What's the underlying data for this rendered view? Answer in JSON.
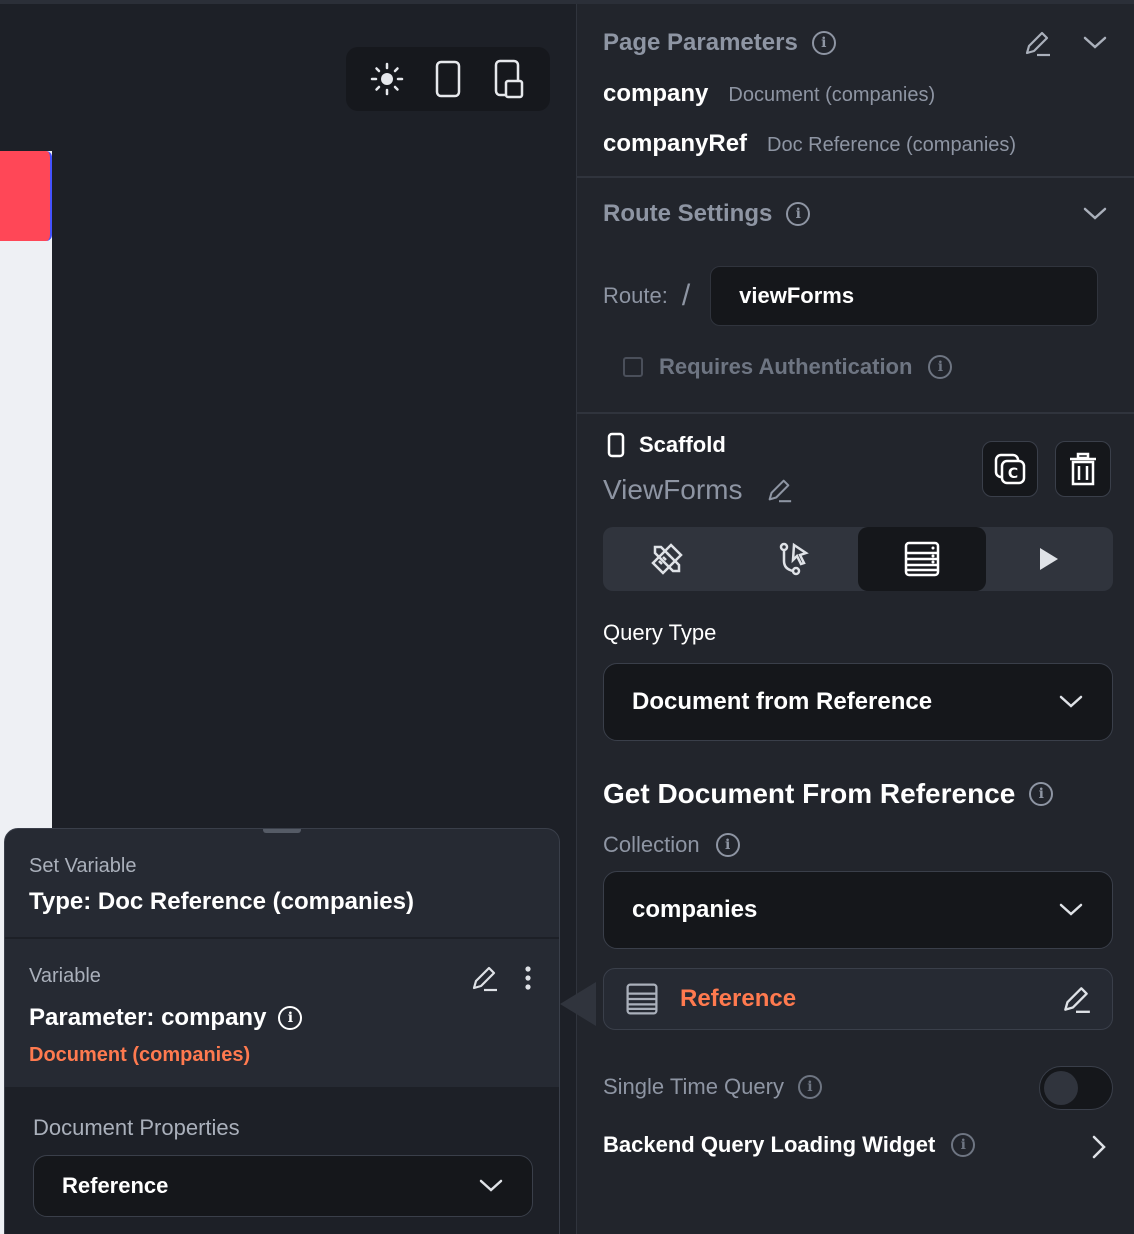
{
  "page_parameters": {
    "title": "Page Parameters",
    "params": [
      {
        "name": "company",
        "type": "Document (companies)"
      },
      {
        "name": "companyRef",
        "type": "Doc Reference (companies)"
      }
    ]
  },
  "route_settings": {
    "title": "Route Settings",
    "route_label": "Route:",
    "slash": "/",
    "route_value": "viewForms",
    "requires_auth_label": "Requires Authentication"
  },
  "widget": {
    "type": "Scaffold",
    "name": "ViewForms"
  },
  "query": {
    "type_label": "Query Type",
    "type_value": "Document from Reference",
    "heading": "Get Document From Reference",
    "collection_label": "Collection",
    "collection_value": "companies",
    "reference_label": "Reference",
    "single_time_label": "Single Time Query",
    "loading_widget_label": "Backend Query Loading Widget"
  },
  "set_variable": {
    "title": "Set Variable",
    "type": "Type: Doc Reference (companies)",
    "variable_label": "Variable",
    "parameter": "Parameter: company",
    "doc_type": "Document (companies)",
    "props_label": "Document Properties",
    "props_value": "Reference"
  },
  "colors": {
    "accent": "#ff7a4f",
    "red": "#ff4757",
    "panel": "#22252c"
  }
}
